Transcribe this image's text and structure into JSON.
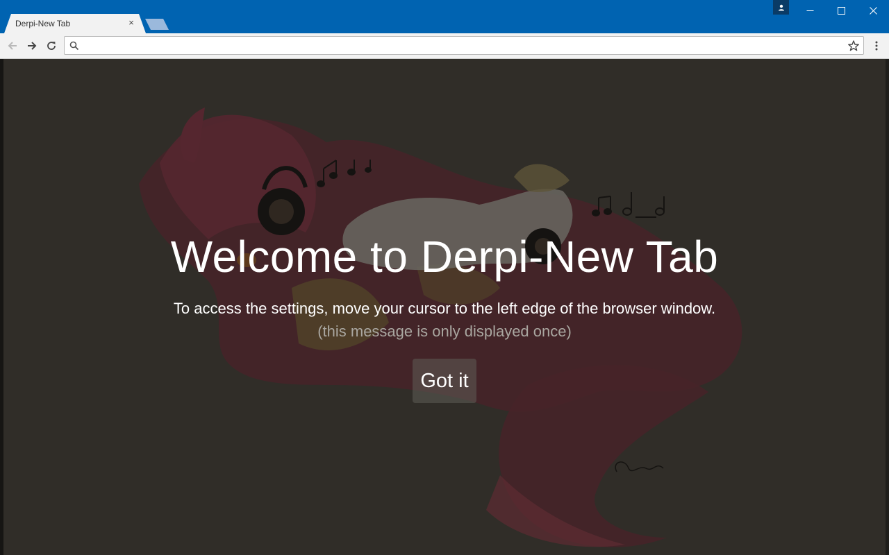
{
  "browser": {
    "tab_title": "Derpi-New Tab",
    "tab_close_glyph": "×",
    "address_value": "",
    "accent_color": "#0063b1"
  },
  "page": {
    "title": "Welcome to Derpi-New Tab",
    "instructions": "To access the settings, move your cursor to the left edge of the browser window.",
    "note": "(this message is only displayed once)",
    "button_label": "Got it"
  }
}
